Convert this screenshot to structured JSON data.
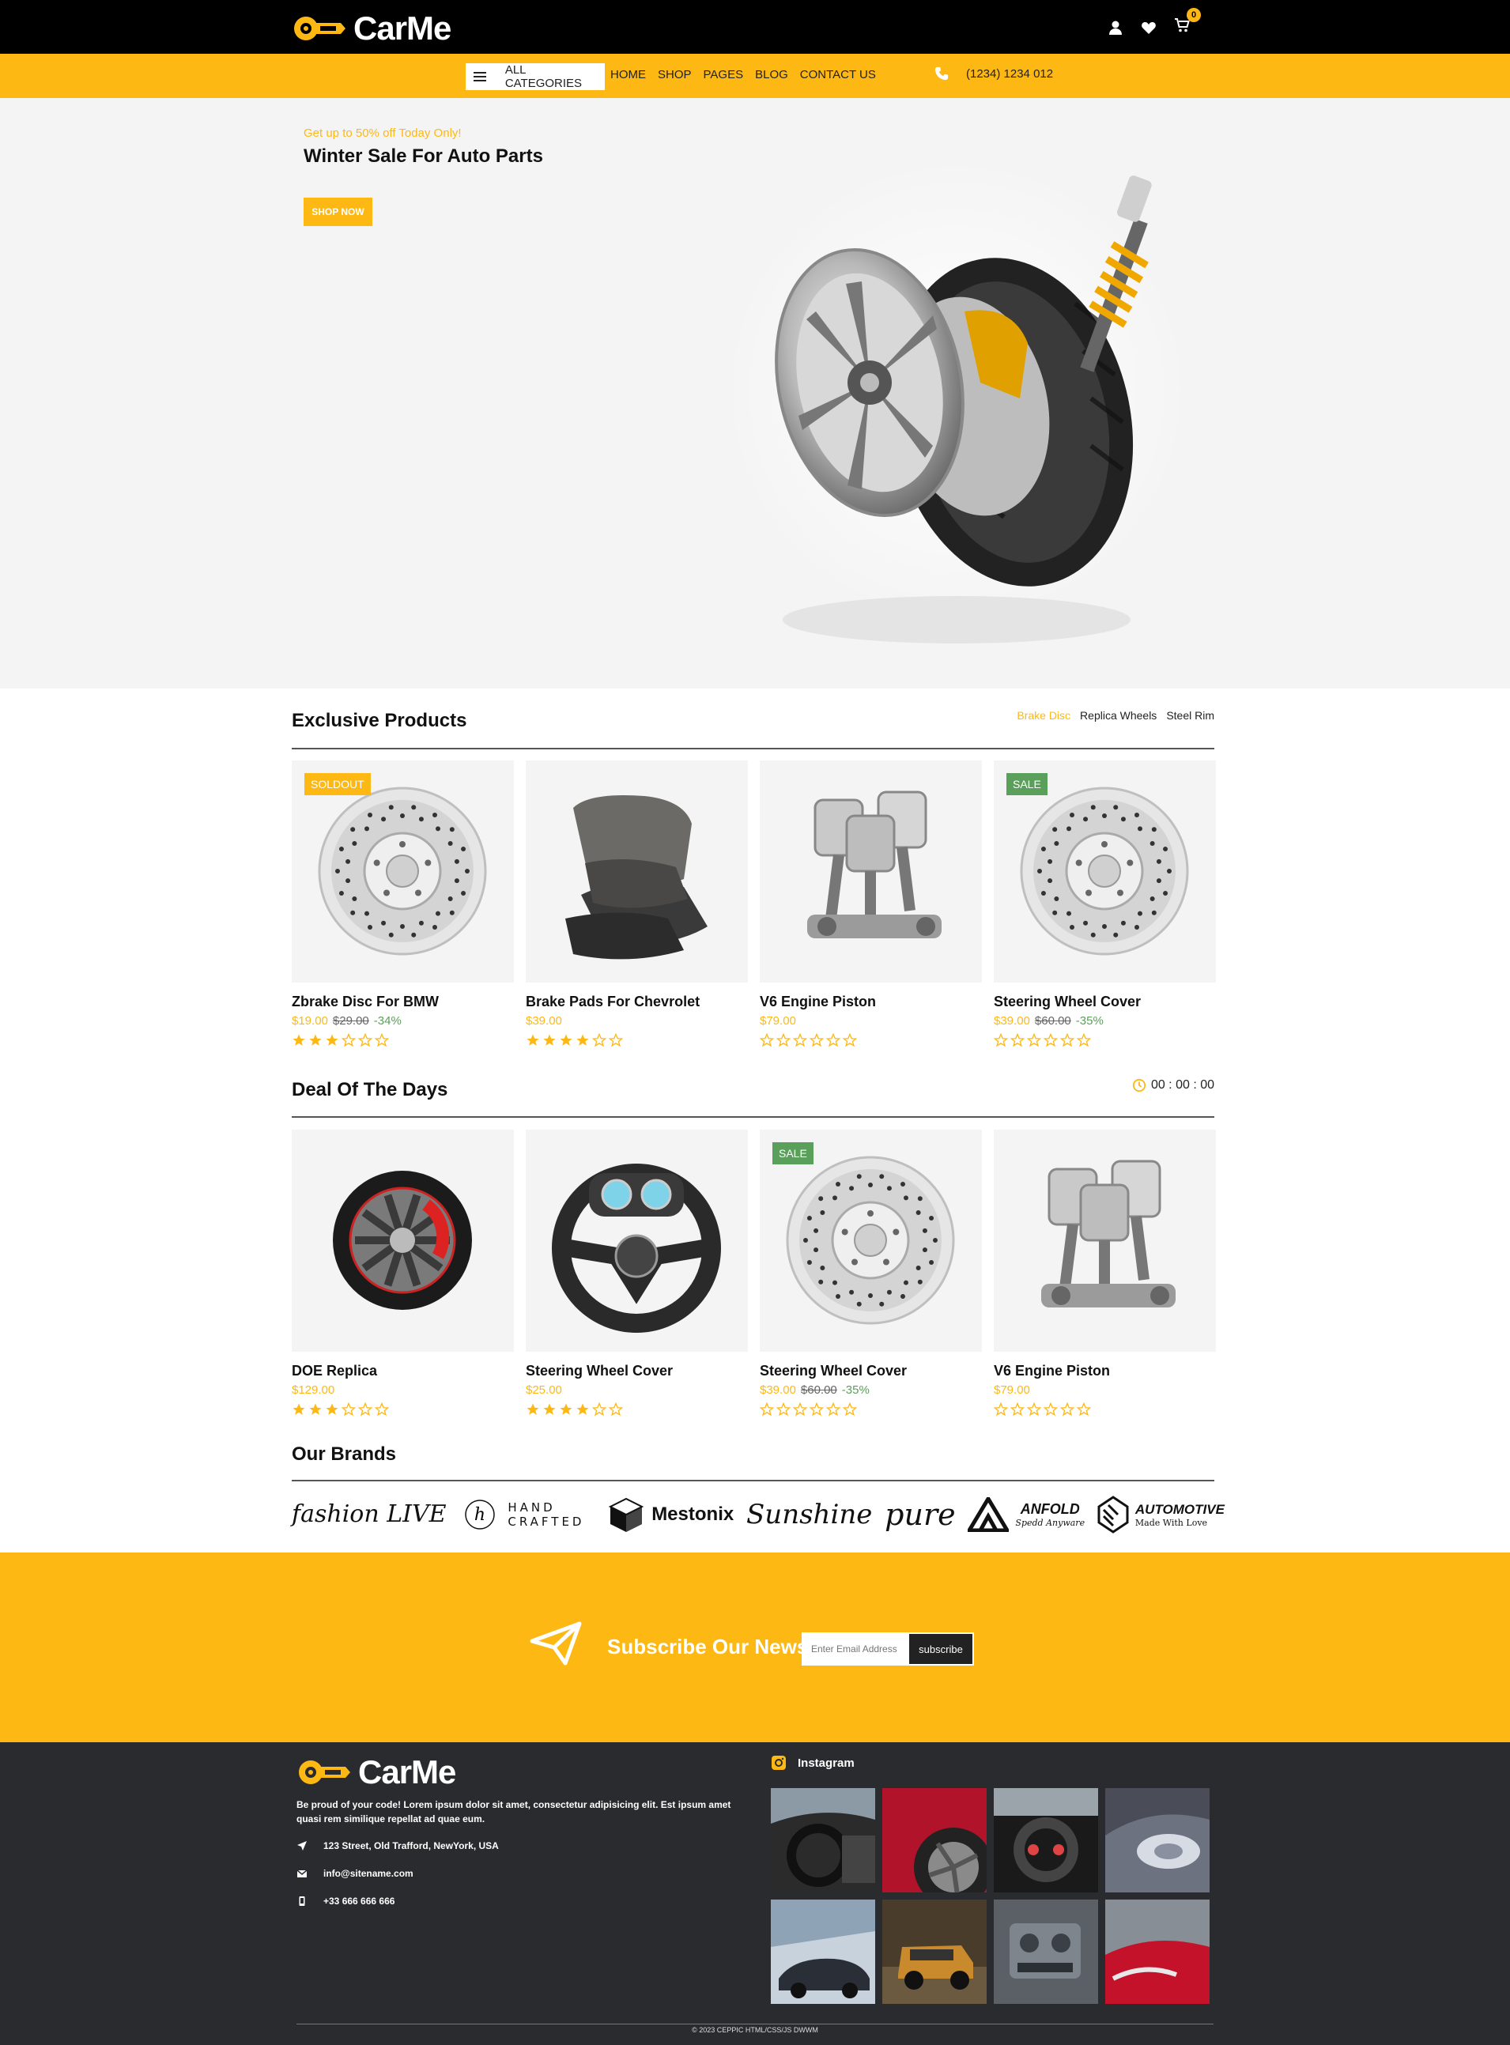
{
  "brand": {
    "name": "CarMe"
  },
  "header": {
    "cart_count": "0"
  },
  "nav": {
    "all_categories": "ALL CATEGORIES",
    "items": [
      "HOME",
      "SHOP",
      "PAGES",
      "BLOG",
      "CONTACT US"
    ],
    "phone": "(1234) 1234 012"
  },
  "hero": {
    "promo": "Get up to 50% off Today Only!",
    "title": "Winter Sale For Auto Parts",
    "button": "SHOP NOW"
  },
  "exclusive": {
    "title": "Exclusive Products",
    "filters": [
      "Brake Disc",
      "Replica Wheels",
      "Steel Rim"
    ],
    "products": [
      {
        "name": "Zbrake Disc For BMW",
        "price": "$19.00",
        "old_price": "$29.00",
        "discount": "-34%",
        "badge": "SOLDOUT",
        "rating": 3,
        "icon": "brake-disc"
      },
      {
        "name": "Brake Pads For Chevrolet",
        "price": "$39.00",
        "old_price": "",
        "discount": "",
        "badge": "",
        "rating": 4,
        "icon": "brake-pads"
      },
      {
        "name": "V6 Engine Piston",
        "price": "$79.00",
        "old_price": "",
        "discount": "",
        "badge": "",
        "rating": 0,
        "icon": "engine-piston"
      },
      {
        "name": "Steering Wheel Cover",
        "price": "$39.00",
        "old_price": "$60.00",
        "discount": "-35%",
        "badge": "SALE",
        "rating": 0,
        "icon": "brake-disc"
      }
    ]
  },
  "deals": {
    "title": "Deal Of The Days",
    "timer": "00 : 00 : 00",
    "products": [
      {
        "name": "DOE Replica",
        "price": "$129.00",
        "old_price": "",
        "discount": "",
        "badge": "",
        "rating": 3,
        "icon": "wheel"
      },
      {
        "name": "Steering Wheel Cover",
        "price": "$25.00",
        "old_price": "",
        "discount": "",
        "badge": "",
        "rating": 4,
        "icon": "steering-wheel"
      },
      {
        "name": "Steering Wheel Cover",
        "price": "$39.00",
        "old_price": "$60.00",
        "discount": "-35%",
        "badge": "SALE",
        "rating": 0,
        "icon": "brake-disc"
      },
      {
        "name": "V6 Engine Piston",
        "price": "$79.00",
        "old_price": "",
        "discount": "",
        "badge": "",
        "rating": 0,
        "icon": "engine-piston"
      }
    ]
  },
  "brands": {
    "title": "Our Brands",
    "items": [
      "fashion LIVE",
      "HAND CRAFTED",
      "Mestonix",
      "Sunshine",
      "pure",
      "ANFOLD",
      "AUTOMOTIVE"
    ],
    "taglines": [
      "Spedd Anyware",
      "Made With Love"
    ]
  },
  "newsletter": {
    "label": "Subscribe Our Newsletter",
    "placeholder": "Enter Email Address",
    "button": "subscribe"
  },
  "footer": {
    "description": "Be proud of your code! Lorem ipsum dolor sit amet, consectetur adipisicing elit. Est ipsum amet quasi rem similique repellat ad quae eum.",
    "address": "123 Street, Old Trafford, NewYork, USA",
    "email": "info@sitename.com",
    "phone": "+33 666 666 666",
    "instagram_title": "Instagram",
    "copyright": "© 2023 CEPPIC HTML/CSS/JS DWWM"
  },
  "colors": {
    "accent": "#fdb813",
    "sale": "#5aa05a",
    "dark": "#2a2b2e"
  }
}
